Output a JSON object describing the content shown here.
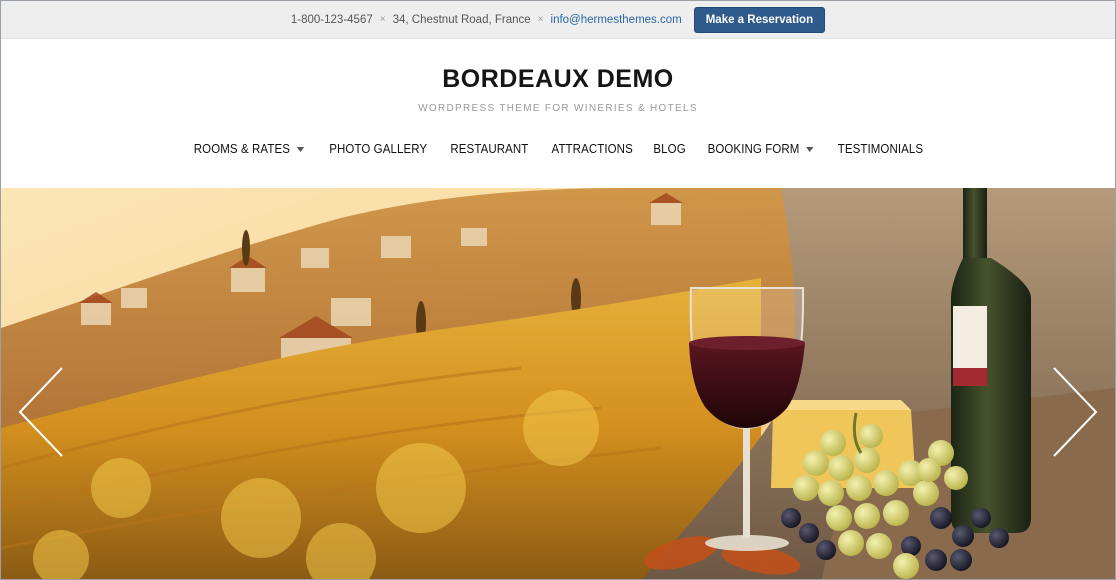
{
  "topbar": {
    "phone": "1-800-123-4567",
    "address": "34, Chestnut Road, France",
    "email": "info@hermesthemes.com",
    "separator": "×",
    "reserve_label": "Make a Reservation"
  },
  "site": {
    "title": "BORDEAUX DEMO",
    "tagline": "WORDPRESS THEME FOR WINERIES & HOTELS"
  },
  "nav": {
    "items": [
      {
        "label": "ROOMS & RATES",
        "dropdown": true
      },
      {
        "label": "PHOTO GALLERY",
        "dropdown": false
      },
      {
        "label": "RESTAURANT",
        "dropdown": false
      },
      {
        "label": "ATTRACTIONS",
        "dropdown": false
      },
      {
        "label": "BLOG",
        "dropdown": false
      },
      {
        "label": "BOOKING FORM",
        "dropdown": true
      },
      {
        "label": "TESTIMONIALS",
        "dropdown": false
      }
    ]
  },
  "hero": {
    "icons": {
      "prev": "chevron-left-icon",
      "next": "chevron-right-icon"
    },
    "colors": {
      "sky": "#f7d99a",
      "vine": "#e0a22a",
      "wine": "#3a0d14",
      "bottle": "#2e3a22"
    }
  }
}
